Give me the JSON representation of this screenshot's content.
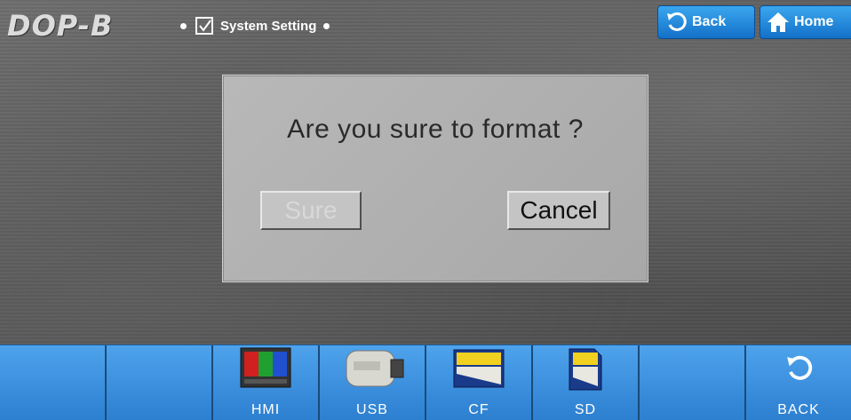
{
  "header": {
    "logo": "DOP-B",
    "breadcrumb_label": "System Setting",
    "back_label": "Back",
    "home_label": "Home"
  },
  "dialog": {
    "message": "Are you sure to format ?",
    "sure_label": "Sure",
    "cancel_label": "Cancel"
  },
  "bottom_bar": {
    "items": [
      {
        "label": "",
        "icon": ""
      },
      {
        "label": "",
        "icon": ""
      },
      {
        "label": "HMI",
        "icon": "hmi-screen-icon"
      },
      {
        "label": "USB",
        "icon": "usb-drive-icon"
      },
      {
        "label": "CF",
        "icon": "cf-card-icon"
      },
      {
        "label": "SD",
        "icon": "sd-card-icon"
      },
      {
        "label": "",
        "icon": ""
      },
      {
        "label": "BACK",
        "icon": "back-arrow-icon"
      }
    ]
  },
  "colors": {
    "accent_blue": "#2d7fd0",
    "dialog_gray": "#b0b0b0"
  }
}
